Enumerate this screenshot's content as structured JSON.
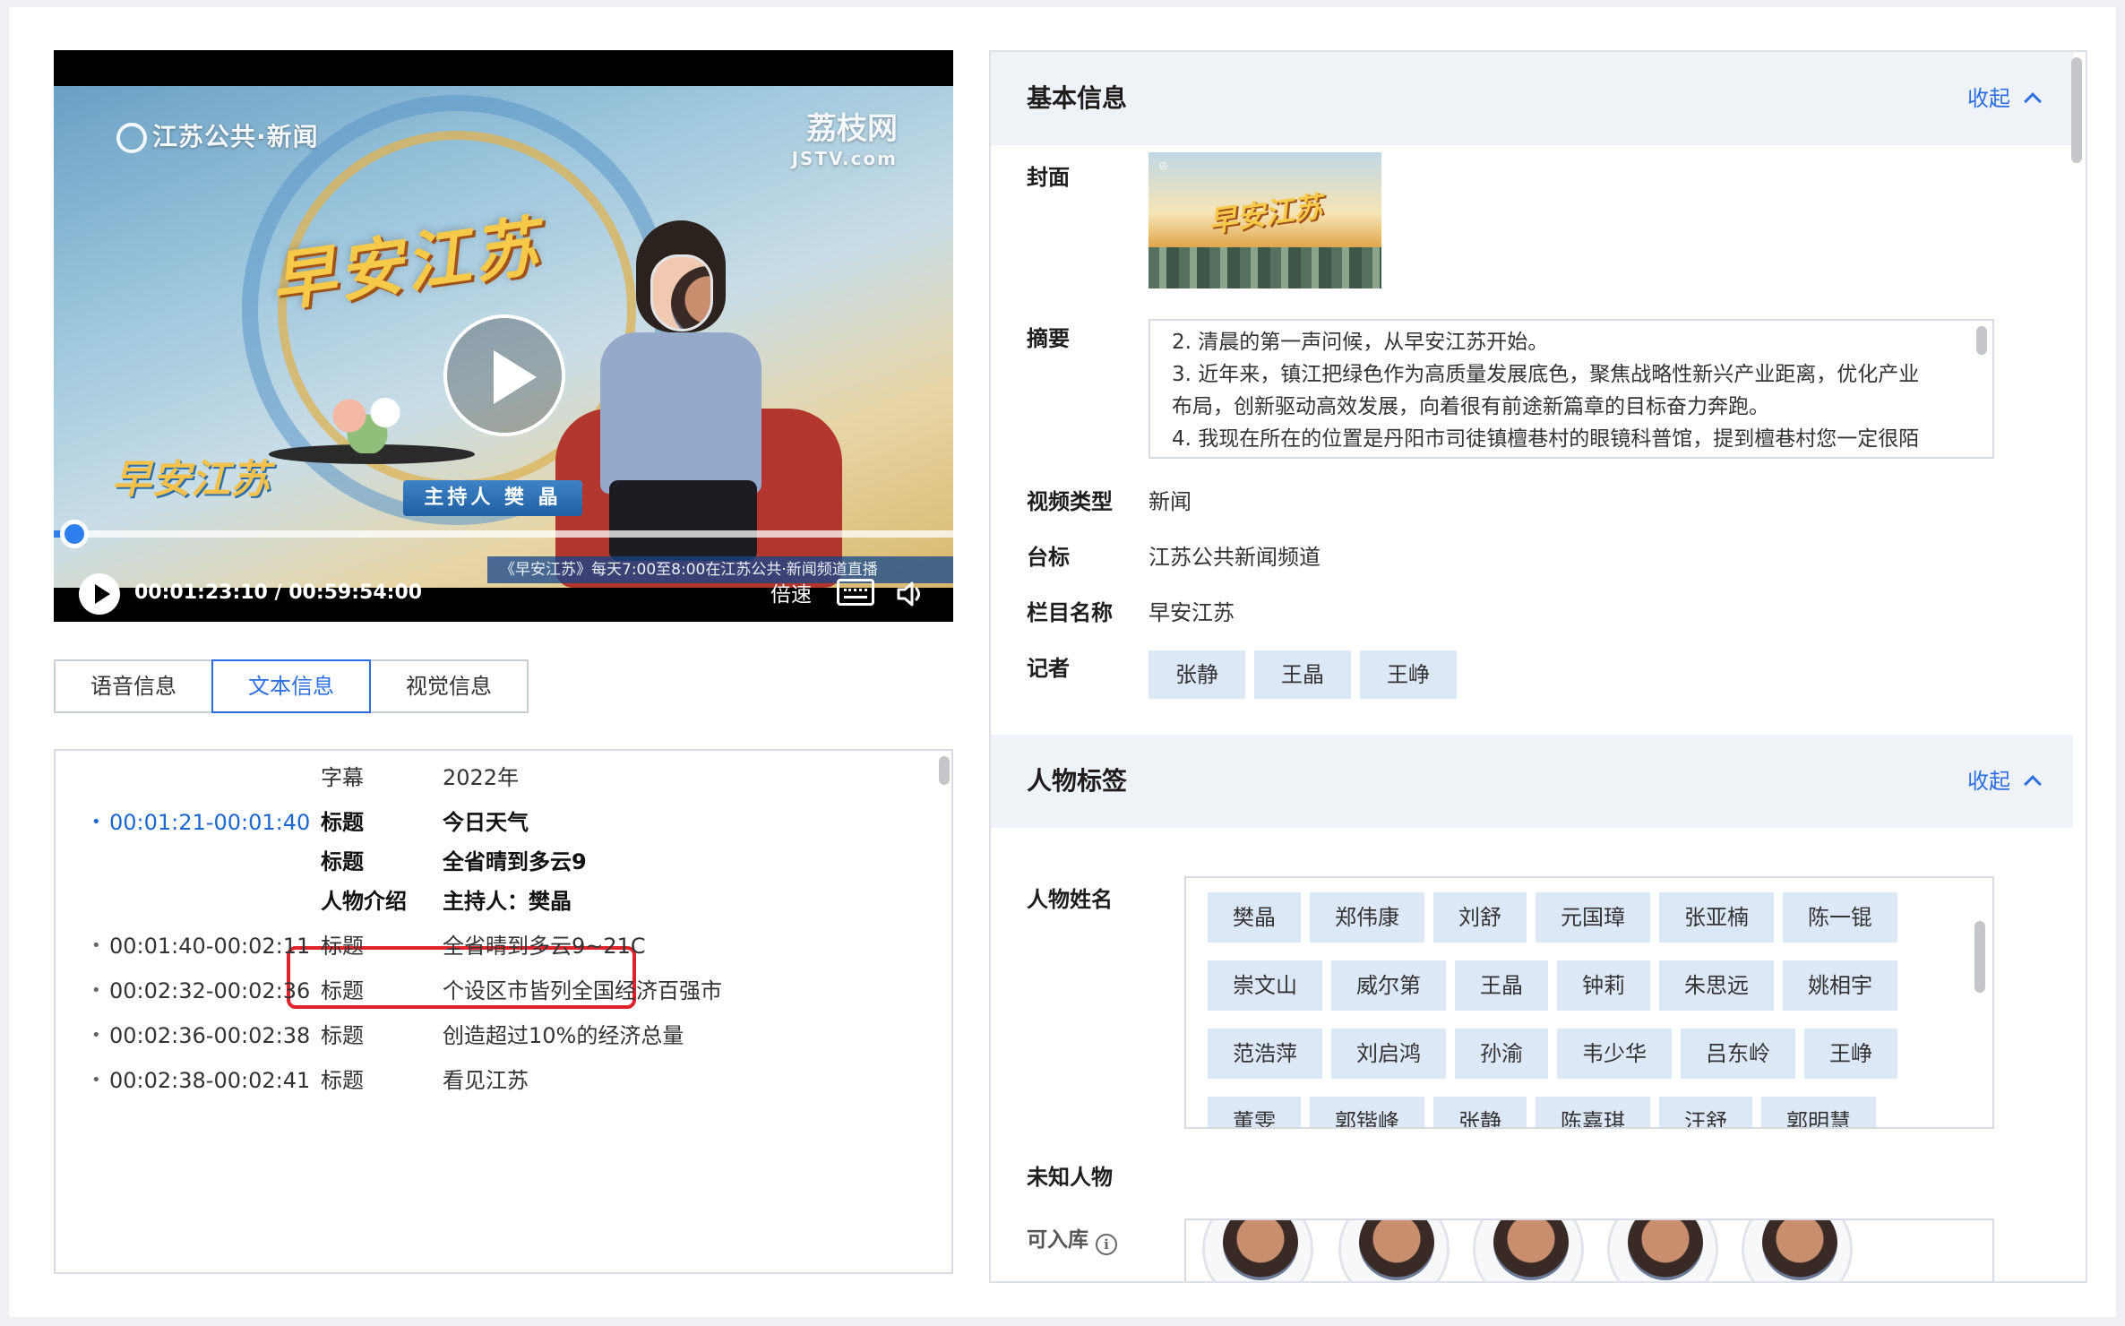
{
  "video": {
    "channel_logo": "江苏公共·新闻",
    "site_logo_cn": "荔枝网",
    "site_logo_en": "JSTV.com",
    "show_logo": "早安江苏",
    "nameplate": "主持人 樊 晶",
    "corner_logo": "早安江苏",
    "ticker": "《早安江苏》每天7:00至8:00在江苏公共·新闻频道直播",
    "current_time": "00:01:23:10",
    "duration": "00:59:54:00",
    "timecode_display": "00:01:23:10 / 00:59:54:00",
    "progress_fraction": 0.023,
    "speed_label": "倍速",
    "icons": [
      "play-icon",
      "subtitles-icon",
      "volume-icon"
    ]
  },
  "tabs": [
    {
      "label": "语音信息",
      "active": false
    },
    {
      "label": "文本信息",
      "active": true
    },
    {
      "label": "视觉信息",
      "active": false
    }
  ],
  "text_info": {
    "rows": [
      {
        "time": "",
        "label": "字幕",
        "value": "2022年",
        "bold": false,
        "highlight": false
      },
      {
        "time": "00:01:21-00:01:40",
        "label": "标题",
        "value": "今日天气",
        "bold": true,
        "highlight": true
      },
      {
        "time": "",
        "label": "标题",
        "value": "全省晴到多云9",
        "bold": true,
        "highlight": false
      },
      {
        "time": "",
        "label": "人物介绍",
        "value": "主持人：樊晶",
        "bold": true,
        "highlight": false,
        "boxed": true
      },
      {
        "time": "00:01:40-00:02:11",
        "label": "标题",
        "value": "全省晴到多云9~21C",
        "bold": false,
        "highlight": false
      },
      {
        "time": "00:02:32-00:02:36",
        "label": "标题",
        "value": "个设区市皆列全国经济百强市",
        "bold": false,
        "highlight": false
      },
      {
        "time": "00:02:36-00:02:38",
        "label": "标题",
        "value": "创造超过10%的经济总量",
        "bold": false,
        "highlight": false
      },
      {
        "time": "00:02:38-00:02:41",
        "label": "标题",
        "value": "看见江苏",
        "bold": false,
        "highlight": false
      }
    ]
  },
  "basic_info": {
    "title": "基本信息",
    "toggle": "收起",
    "cover_label": "封面",
    "cover_text": "早安江苏",
    "summary_label": "摘要",
    "summary_lines": [
      "2. 清晨的第一声问候，从早安江苏开始。",
      "3. 近年来，镇江把绿色作为高质量发展底色，聚焦战略性新兴产业距离，优化产业",
      "布局，创新驱动高效发展，向着很有前途新篇章的目标奋力奔跑。",
      "4. 我现在所在的位置是丹阳市司徒镇檀巷村的眼镜科普馆，提到檀巷村您一定很陌"
    ],
    "fields": [
      {
        "label": "视频类型",
        "value": "新闻"
      },
      {
        "label": "台标",
        "value": "江苏公共新闻频道"
      },
      {
        "label": "栏目名称",
        "value": "早安江苏"
      }
    ],
    "reporter_label": "记者",
    "reporters": [
      "张静",
      "王晶",
      "王峥"
    ]
  },
  "people_tags": {
    "title": "人物标签",
    "toggle": "收起",
    "names_label": "人物姓名",
    "rows": [
      [
        "樊晶",
        "郑伟康",
        "刘舒",
        "元国璋",
        "张亚楠",
        "陈一锟"
      ],
      [
        "崇文山",
        "威尔第",
        "王晶",
        "钟莉",
        "朱思远",
        "姚相宇"
      ],
      [
        "范浩萍",
        "刘启鸿",
        "孙渝",
        "韦少华",
        "吕东岭",
        "王峥"
      ],
      [
        "董雯",
        "郭锴峰",
        "张静",
        "陈嘉琪",
        "汪舒",
        "郭明慧"
      ]
    ],
    "unknown_label": "未知人物",
    "storable_label": "可入库",
    "face_count": 5
  },
  "colors": {
    "accent": "#2d6fe0",
    "highlight_time": "#1a67d2",
    "chip_bg": "#dde8f7",
    "section_head_bg": "#eff3f8",
    "red_box": "#e0232a"
  }
}
